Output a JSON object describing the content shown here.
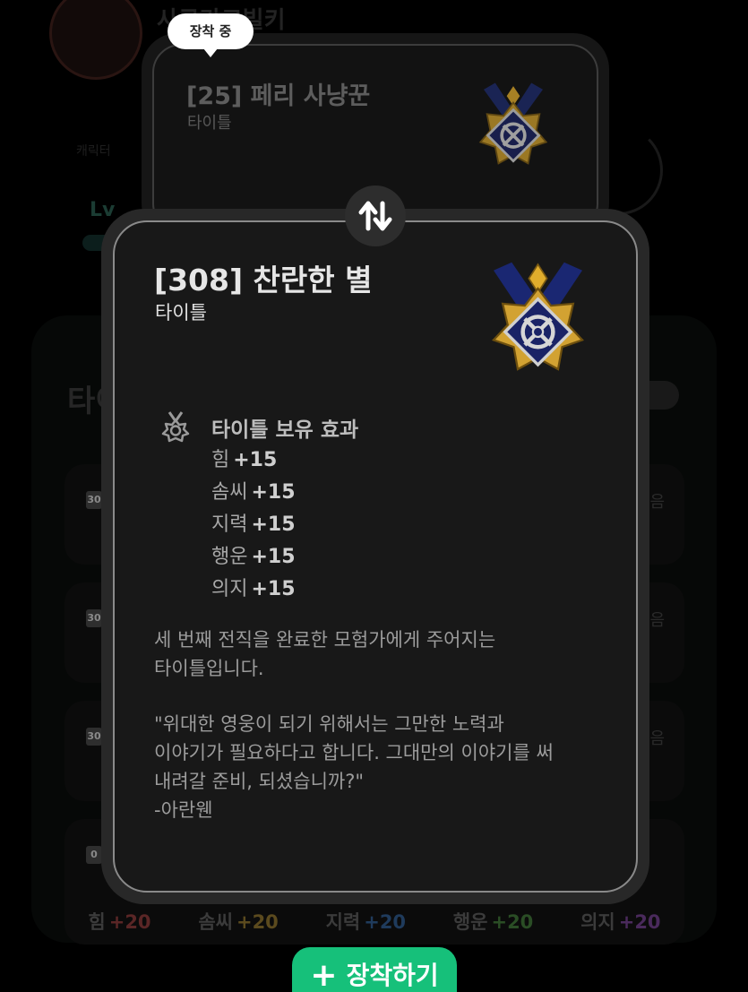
{
  "background": {
    "character_name": "사쿠라코빌키",
    "character_sub": "캐릭터",
    "level_label": "Lv",
    "section_title": "타이틀",
    "row_tags": [
      "30",
      "30",
      "30",
      "0"
    ],
    "row_right": [
      "음",
      "음",
      "음"
    ],
    "stats": [
      {
        "name": "힘",
        "value": "+20"
      },
      {
        "name": "솜씨",
        "value": "+20"
      },
      {
        "name": "지력",
        "value": "+20"
      },
      {
        "name": "행운",
        "value": "+20"
      },
      {
        "name": "의지",
        "value": "+20"
      }
    ]
  },
  "equipped_card": {
    "badge": "장착 중",
    "title": "[25] 페리 사냥꾼",
    "type": "타이틀",
    "icon": "medal-icon"
  },
  "swap_icon": "swap-arrows-icon",
  "selected_card": {
    "title": "[308] 찬란한 별",
    "type": "타이틀",
    "icon": "medal-icon",
    "effect_heading": "타이틀 보유 효과",
    "effect_icon": "medal-outline-icon",
    "effects": [
      {
        "stat": "힘",
        "value": "+15"
      },
      {
        "stat": "솜씨",
        "value": "+15"
      },
      {
        "stat": "지력",
        "value": "+15"
      },
      {
        "stat": "행운",
        "value": "+15"
      },
      {
        "stat": "의지",
        "value": "+15"
      }
    ],
    "description": "세 번째 전직을 완료한 모험가에게 주어지는\n타이틀입니다.",
    "quote": "\"위대한 영웅이 되기 위해서는 그만한 노력과\n이야기가 필요하다고 합니다. 그대만의 이야기를 써\n내려갈 준비, 되셨습니까?\"",
    "quote_author": "-아란웬"
  },
  "equip_button": {
    "icon": "plus-icon",
    "label": "장착하기",
    "color": "#16c07a"
  }
}
